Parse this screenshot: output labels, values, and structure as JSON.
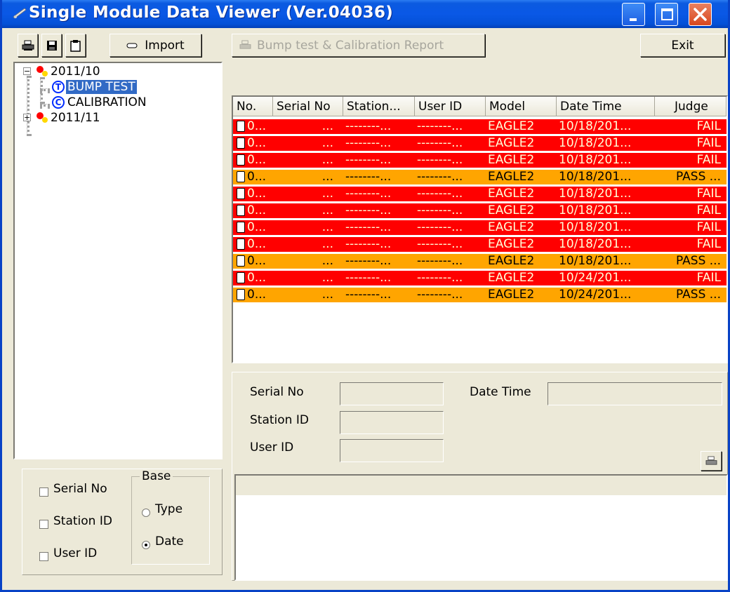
{
  "window": {
    "title": "Single Module Data Viewer (Ver.04036)"
  },
  "toolbar": {
    "import_label": "Import",
    "report_label": "Bump test & Calibration Report",
    "exit_label": "Exit"
  },
  "tree": {
    "nodes": [
      {
        "label": "2011/10",
        "expander": "⊟"
      },
      {
        "label": "BUMP TEST",
        "badge": "T"
      },
      {
        "label": "CALIBRATION",
        "badge": "C"
      },
      {
        "label": "2011/11",
        "expander": "⊞"
      }
    ]
  },
  "list": {
    "columns": [
      "No.",
      "Serial No",
      "Station...",
      "User ID",
      "Model",
      "Date Time",
      "Judge"
    ],
    "rows": [
      {
        "no": "0...",
        "serial": "...",
        "station": "--------...",
        "user": "--------...",
        "model": "EAGLE2",
        "date": "10/18/201...",
        "judge": "FAIL",
        "status": "fail"
      },
      {
        "no": "0...",
        "serial": "...",
        "station": "--------...",
        "user": "--------...",
        "model": "EAGLE2",
        "date": "10/18/201...",
        "judge": "FAIL",
        "status": "fail"
      },
      {
        "no": "0...",
        "serial": "...",
        "station": "--------...",
        "user": "--------...",
        "model": "EAGLE2",
        "date": "10/18/201...",
        "judge": "FAIL",
        "status": "fail"
      },
      {
        "no": "0...",
        "serial": "...",
        "station": "--------...",
        "user": "--------...",
        "model": "EAGLE2",
        "date": "10/18/201...",
        "judge": "PASS ...",
        "status": "pass"
      },
      {
        "no": "0...",
        "serial": "...",
        "station": "--------...",
        "user": "--------...",
        "model": "EAGLE2",
        "date": "10/18/201...",
        "judge": "FAIL",
        "status": "fail"
      },
      {
        "no": "0...",
        "serial": "...",
        "station": "--------...",
        "user": "--------...",
        "model": "EAGLE2",
        "date": "10/18/201...",
        "judge": "FAIL",
        "status": "fail"
      },
      {
        "no": "0...",
        "serial": "...",
        "station": "--------...",
        "user": "--------...",
        "model": "EAGLE2",
        "date": "10/18/201...",
        "judge": "FAIL",
        "status": "fail"
      },
      {
        "no": "0...",
        "serial": "...",
        "station": "--------...",
        "user": "--------...",
        "model": "EAGLE2",
        "date": "10/18/201...",
        "judge": "FAIL",
        "status": "fail"
      },
      {
        "no": "0...",
        "serial": "...",
        "station": "--------...",
        "user": "--------...",
        "model": "EAGLE2",
        "date": "10/18/201...",
        "judge": "PASS ...",
        "status": "pass"
      },
      {
        "no": "0...",
        "serial": "...",
        "station": "--------...",
        "user": "--------...",
        "model": "EAGLE2",
        "date": "10/24/201...",
        "judge": "FAIL",
        "status": "fail"
      },
      {
        "no": "0...",
        "serial": "...",
        "station": "--------...",
        "user": "--------...",
        "model": "EAGLE2",
        "date": "10/24/201...",
        "judge": "PASS ...",
        "status": "pass"
      }
    ]
  },
  "detail": {
    "serial_label": "Serial No",
    "station_label": "Station ID",
    "user_label": "User ID",
    "datetime_label": "Date Time"
  },
  "filter": {
    "serial_label": "Serial No",
    "station_label": "Station ID",
    "user_label": "User ID",
    "base_label": "Base",
    "type_label": "Type",
    "date_label": "Date",
    "selected_base": "Date"
  },
  "colors": {
    "fail": "#ff0000",
    "pass": "#ffa500",
    "selection": "#316ac5",
    "titlebar": "#0a58e6"
  }
}
